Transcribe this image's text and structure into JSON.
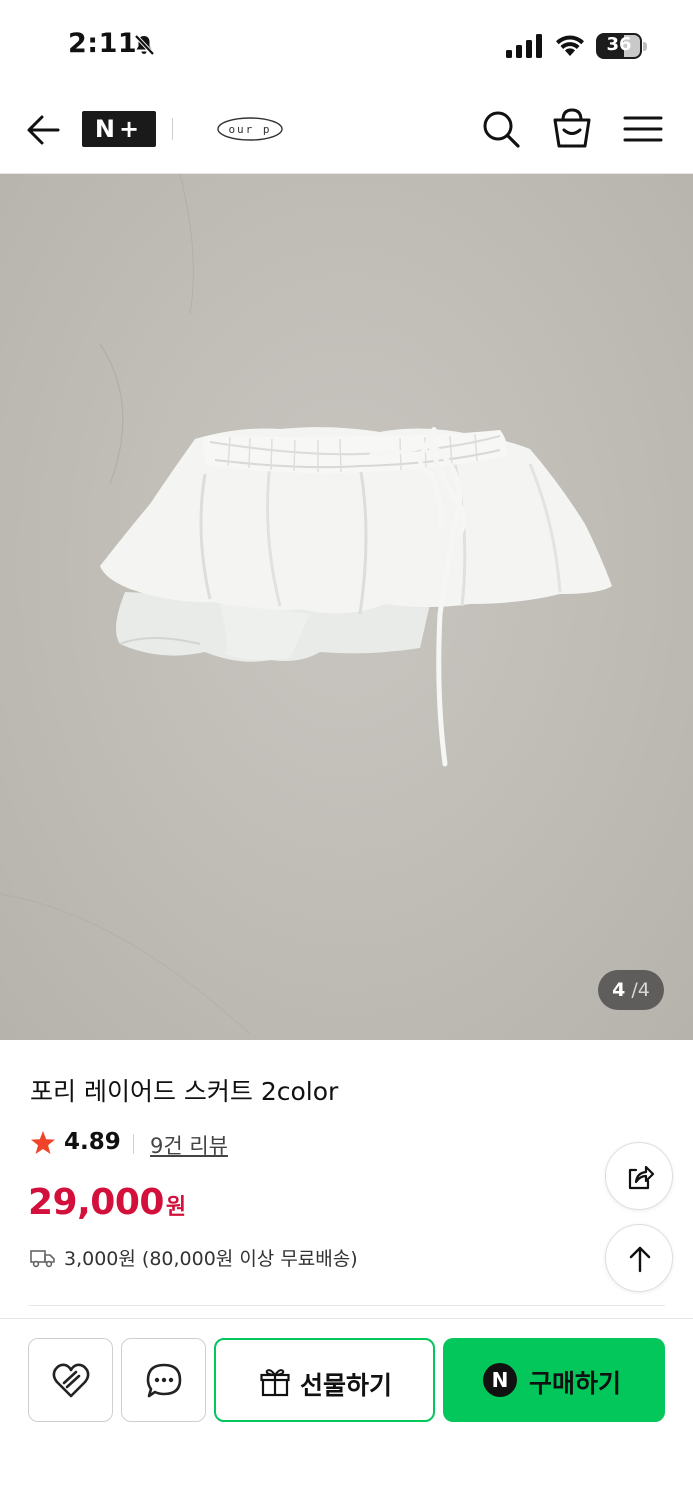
{
  "status_bar": {
    "time": "2:11",
    "battery": "36"
  },
  "header": {
    "brand_logo": "N+",
    "store_logo": "our p",
    "icons": [
      "back-arrow-icon",
      "search-icon",
      "shopping-bag-icon",
      "hamburger-menu-icon"
    ]
  },
  "gallery": {
    "current": "4",
    "separator": "/",
    "total": "4"
  },
  "product": {
    "title": "포리 레이어드 스커트 2color",
    "rating": "4.89",
    "review_link": "9건 리뷰",
    "price": "29,000",
    "price_unit": "원",
    "shipping": "3,000원 (80,000원 이상 무료배송)"
  },
  "bottom_bar": {
    "gift_label": "선물하기",
    "buy_badge": "N",
    "buy_label": "구매하기"
  },
  "colors": {
    "price": "#d3103c",
    "naver_green": "#03c75a",
    "star": "#f0442a"
  }
}
